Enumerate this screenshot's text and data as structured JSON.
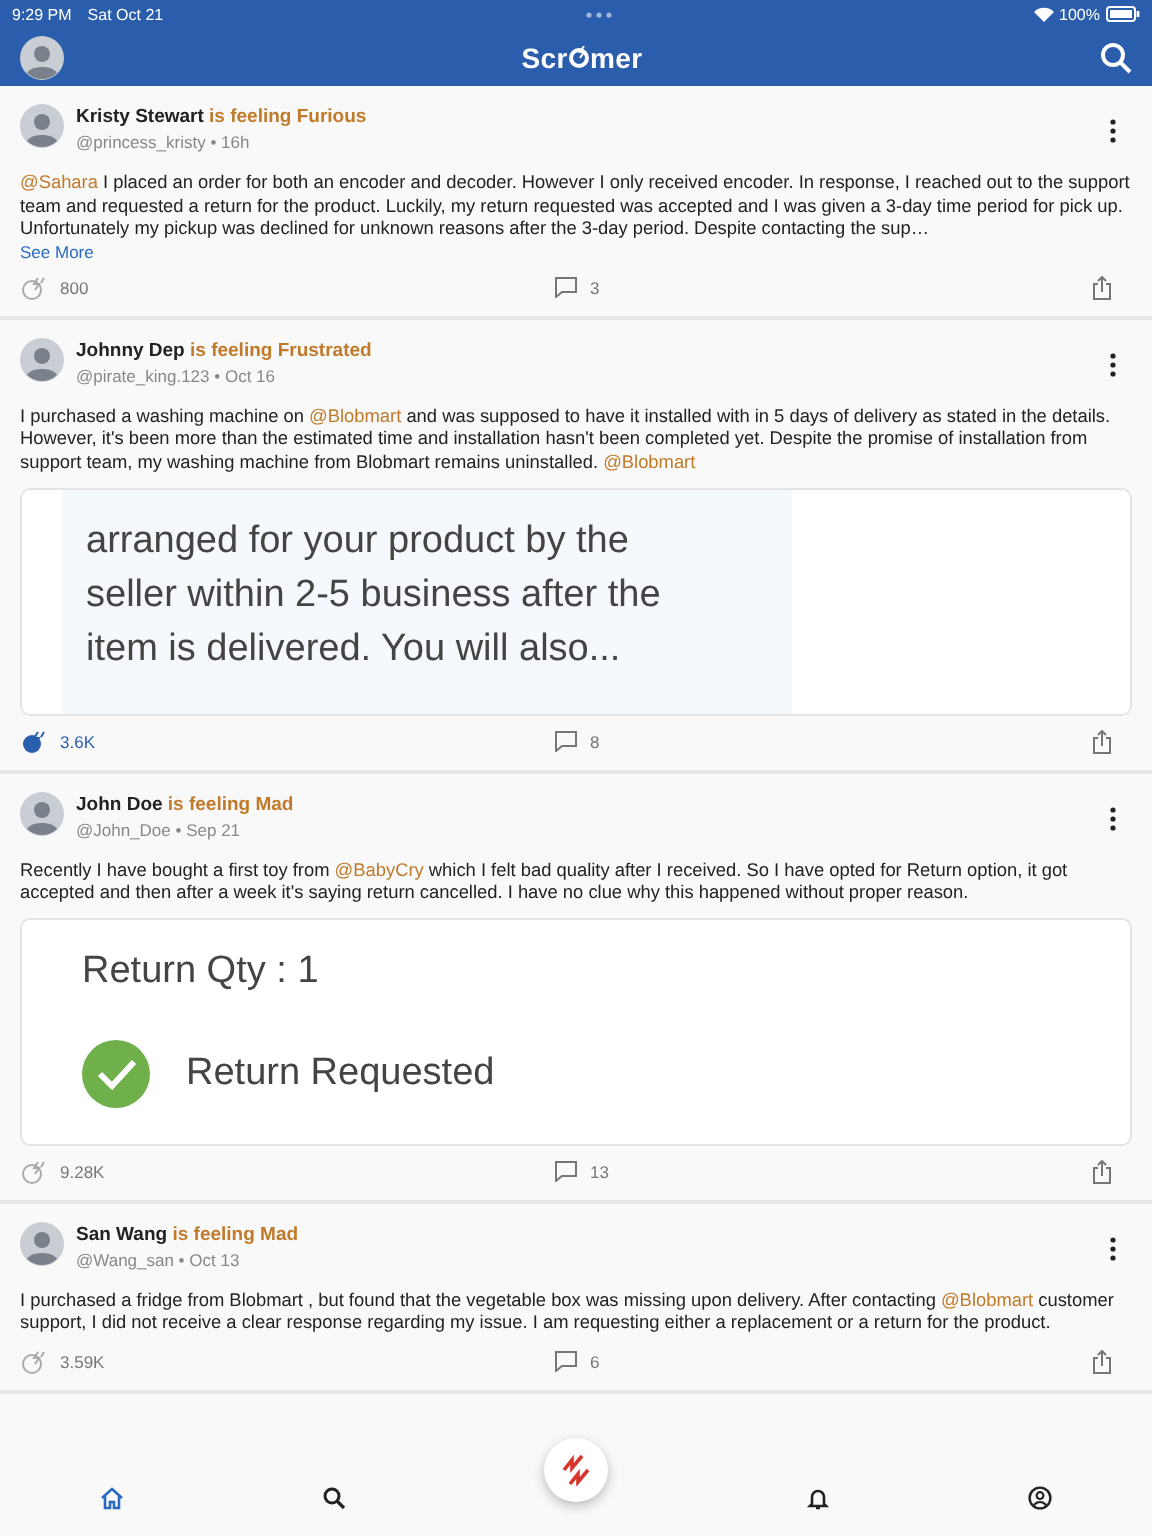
{
  "status_bar": {
    "time": "9:29 PM",
    "date": "Sat Oct 21",
    "battery": "100%"
  },
  "app_bar": {
    "logo_start": "Scr",
    "logo_end": "mer"
  },
  "posts": [
    {
      "author": "Kristy Stewart",
      "feeling": "is feeling Furious",
      "meta": "@princess_kristy • 16h",
      "body": [
        {
          "kind": "mention",
          "text": "@Sahara"
        },
        {
          "kind": "plain",
          "text": " I placed an order for both an encoder and decoder. However I only received encoder. In response, I reached out to the support team and requested a return for the product. Luckily, my return requested was accepted and I was given a 3-day time period for pick up. Unfortunately my pickup was declined for unknown reasons after the 3-day period. Despite contacting the sup…"
        }
      ],
      "see_more": "See More",
      "reactions": "800",
      "reacted": false,
      "comments": "3"
    },
    {
      "author": "Johnny Dep",
      "feeling": "is feeling Frustrated",
      "meta": "@pirate_king.123 • Oct 16",
      "body": [
        {
          "kind": "plain",
          "text": "I purchased a washing machine on "
        },
        {
          "kind": "mention",
          "text": "@Blobmart"
        },
        {
          "kind": "plain",
          "text": " and was supposed to have it installed with in 5 days of delivery as stated in the details. However, it's been more than the estimated time and installation hasn't been completed yet. Despite the promise of installation from support team, my washing machine from Blobmart remains uninstalled. "
        },
        {
          "kind": "mention",
          "text": "@Blobmart"
        }
      ],
      "attachment": {
        "kind": "note",
        "lines": [
          {
            "kind": "text",
            "text": "arranged for your product by the"
          },
          {
            "kind": "text",
            "text": "seller within 2-5 business after the"
          },
          {
            "kind": "text",
            "text": "item is delivered. You will also..."
          }
        ]
      },
      "reactions": "3.6K",
      "reacted": true,
      "comments": "8"
    },
    {
      "author": "John Doe",
      "feeling": "is feeling Mad",
      "meta": "@John_Doe • Sep 21",
      "body": [
        {
          "kind": "plain",
          "text": "Recently I have bought a first toy from "
        },
        {
          "kind": "mention",
          "text": "@BabyCry"
        },
        {
          "kind": "plain",
          "text": " which I felt bad quality after I received. So I have opted for Return option, it got accepted and then after a week it's saying return cancelled. I have no clue why this happened without proper reason."
        }
      ],
      "attachment": {
        "kind": "receipt",
        "lines": [
          {
            "kind": "text",
            "text": "Return Qty :  1"
          },
          {
            "kind": "status",
            "text": "Return Requested"
          }
        ]
      },
      "reactions": "9.28K",
      "reacted": false,
      "comments": "13"
    },
    {
      "author": "San Wang",
      "feeling": "is feeling Mad",
      "meta": "@Wang_san • Oct 13",
      "body": [
        {
          "kind": "plain",
          "text": "I purchased a fridge from Blobmart , but found that the vegetable box was missing upon delivery. After contacting "
        },
        {
          "kind": "mention",
          "text": "@Blobmart"
        },
        {
          "kind": "plain",
          "text": " customer support, I did not receive a clear response regarding my issue. I am requesting either a replacement or a return for the product."
        }
      ],
      "reactions": "3.59K",
      "reacted": false,
      "comments": "6"
    }
  ],
  "nav": [
    {
      "kind": "home",
      "selected": true
    },
    {
      "kind": "search",
      "selected": false
    },
    {
      "kind": "fab"
    },
    {
      "kind": "bell",
      "selected": false
    },
    {
      "kind": "profile",
      "selected": false
    }
  ]
}
